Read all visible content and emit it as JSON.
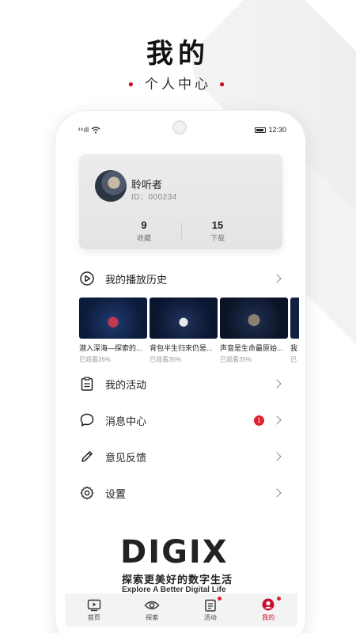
{
  "hero": {
    "title": "我的",
    "subtitle": "个人中心"
  },
  "status_bar": {
    "signal": "⁴⁶ıll",
    "time": "12:30"
  },
  "profile": {
    "name": "聆听者",
    "id": "ID：000234",
    "stats": [
      {
        "value": "9",
        "label": "收藏"
      },
      {
        "value": "15",
        "label": "下载"
      }
    ]
  },
  "history": {
    "label": "我的播放历史",
    "videos": [
      {
        "title": "潜入深海—探索的...",
        "progress": "已观看35%"
      },
      {
        "title": "背包半生归来仍是...",
        "progress": "已观看35%"
      },
      {
        "title": "声音是生命最原始...",
        "progress": "已观看35%"
      },
      {
        "title": "我",
        "progress": "已"
      }
    ]
  },
  "menu": {
    "activities": "我的活动",
    "messages": "消息中心",
    "messages_badge": "1",
    "feedback": "意见反馈",
    "settings": "设置"
  },
  "brand": {
    "logo": "DIGIX",
    "slogan_cn": "探索更美好的数字生活",
    "slogan_en": "Explore A Better Digital Life"
  },
  "nav": {
    "home": "首页",
    "explore": "探索",
    "activities": "活动",
    "mine": "我的"
  },
  "colors": {
    "accent": "#c8102e",
    "badge": "#e0212e"
  }
}
